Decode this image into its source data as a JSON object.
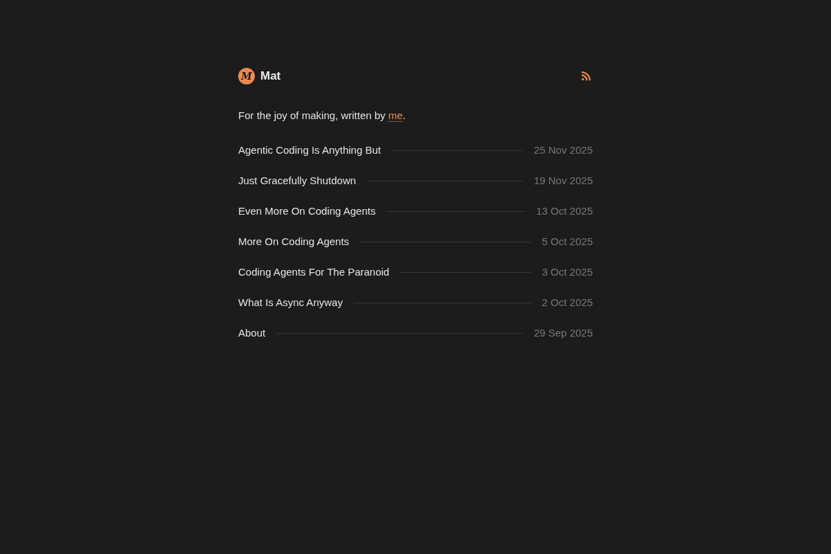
{
  "header": {
    "logo": "M",
    "name": "Mat"
  },
  "tagline": {
    "before": "For the joy of making, written by ",
    "link": "me",
    "after": "."
  },
  "posts": [
    {
      "title": "Agentic Coding Is Anything But",
      "date": "25 Nov 2025"
    },
    {
      "title": "Just Gracefully Shutdown",
      "date": "19 Nov 2025"
    },
    {
      "title": "Even More On Coding Agents",
      "date": "13 Oct 2025"
    },
    {
      "title": "More On Coding Agents",
      "date": "5 Oct 2025"
    },
    {
      "title": "Coding Agents For The Paranoid",
      "date": "3 Oct 2025"
    },
    {
      "title": "What Is Async Anyway",
      "date": "2 Oct 2025"
    },
    {
      "title": "About",
      "date": "29 Sep 2025"
    }
  ]
}
